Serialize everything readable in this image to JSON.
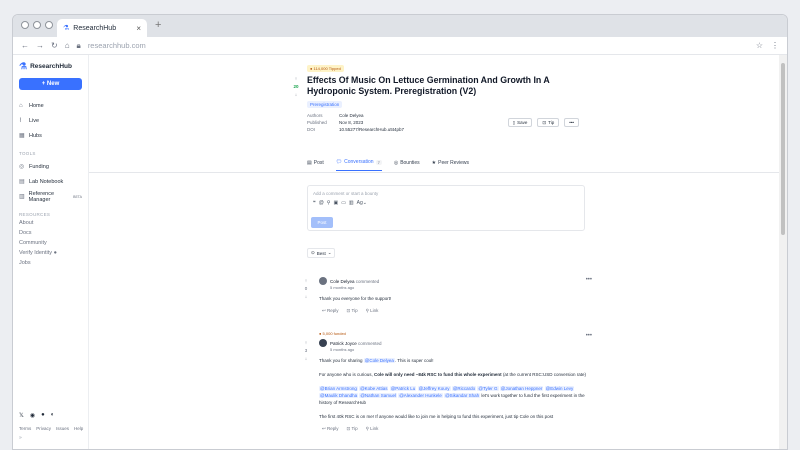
{
  "browser": {
    "tab_title": "ResearchHub",
    "url": "researchhub.com"
  },
  "sidebar": {
    "brand": "ResearchHub",
    "new_label": "+ New",
    "items": [
      {
        "label": "Home"
      },
      {
        "label": "Live"
      },
      {
        "label": "Hubs"
      }
    ],
    "tools_header": "TOOLS",
    "tools": [
      {
        "label": "Funding"
      },
      {
        "label": "Lab Notebook"
      },
      {
        "label": "Reference Manager"
      }
    ],
    "beta": "BETA",
    "resources_header": "RESOURCES",
    "resources": [
      "About",
      "Docs",
      "Community",
      "Verify Identity",
      "Jobs"
    ],
    "footer": [
      "Terms",
      "Privacy",
      "Issues",
      "Help"
    ]
  },
  "paper": {
    "badge": "114,000 Tipped",
    "votes": "20",
    "title": "Effects Of Music On Lettuce Germination And Growth In A Hydroponic System. Preregistration (V2)",
    "tag": "Preregistration",
    "authors_k": "Authors",
    "authors_v": "Cole Delyea",
    "published_k": "Published",
    "published_v": "Nov 8, 2023",
    "doi_k": "DOI",
    "doi_v": "10.55277/ResearchHub.u5t4pb7",
    "save": "Save",
    "tip": "Tip"
  },
  "tabs": [
    {
      "label": "Post"
    },
    {
      "label": "Conversation",
      "count": "7"
    },
    {
      "label": "Bounties"
    },
    {
      "label": "Peer Reviews"
    }
  ],
  "editor": {
    "placeholder": "Add a comment or start a bounty",
    "post": "Post"
  },
  "sort": "Best",
  "comments": [
    {
      "author": "Cole Delyea",
      "verb": "commented",
      "time": "5 months ago",
      "votes": "0",
      "body": "Thank you everyone for the support!",
      "reply": "Reply",
      "tip": "Tip",
      "link": "Link"
    },
    {
      "funded": "5,000 funded",
      "author": "Patrick Joyce",
      "verb": "commented",
      "time": "5 months ago",
      "votes": "3",
      "p1a": "Thank you for sharing ",
      "p1m": "@Cole Delyea",
      "p1b": ". This is super cool!",
      "p2a": "For anyone who is curious, ",
      "p2b": "Cole will only need ~84k RSC to fund this whole experiment",
      "p2c": " (at the current RSC:USD conversion rate)",
      "mentions": [
        "@Brian Armstrong",
        "@Kobe Attias",
        "@Patrick Lu",
        "@Jeffrey Koury",
        "@Riccardo",
        "@Tyler G",
        "@Jonathan Heppner",
        "@Edwin Levy",
        "@Maulik Dhandha",
        "@Nathan Samuel",
        "@Alexander Hunkele",
        "@Sikandar Shah"
      ],
      "p3tail": " let's work together to fund the first experiment in the history of ResearchHub",
      "p4": "The first 40k RSC is on me! If anyone would like to join me in helping to fund this experiment, just tip Cole on this post",
      "reply": "Reply",
      "tip": "Tip",
      "link": "Link"
    }
  ]
}
